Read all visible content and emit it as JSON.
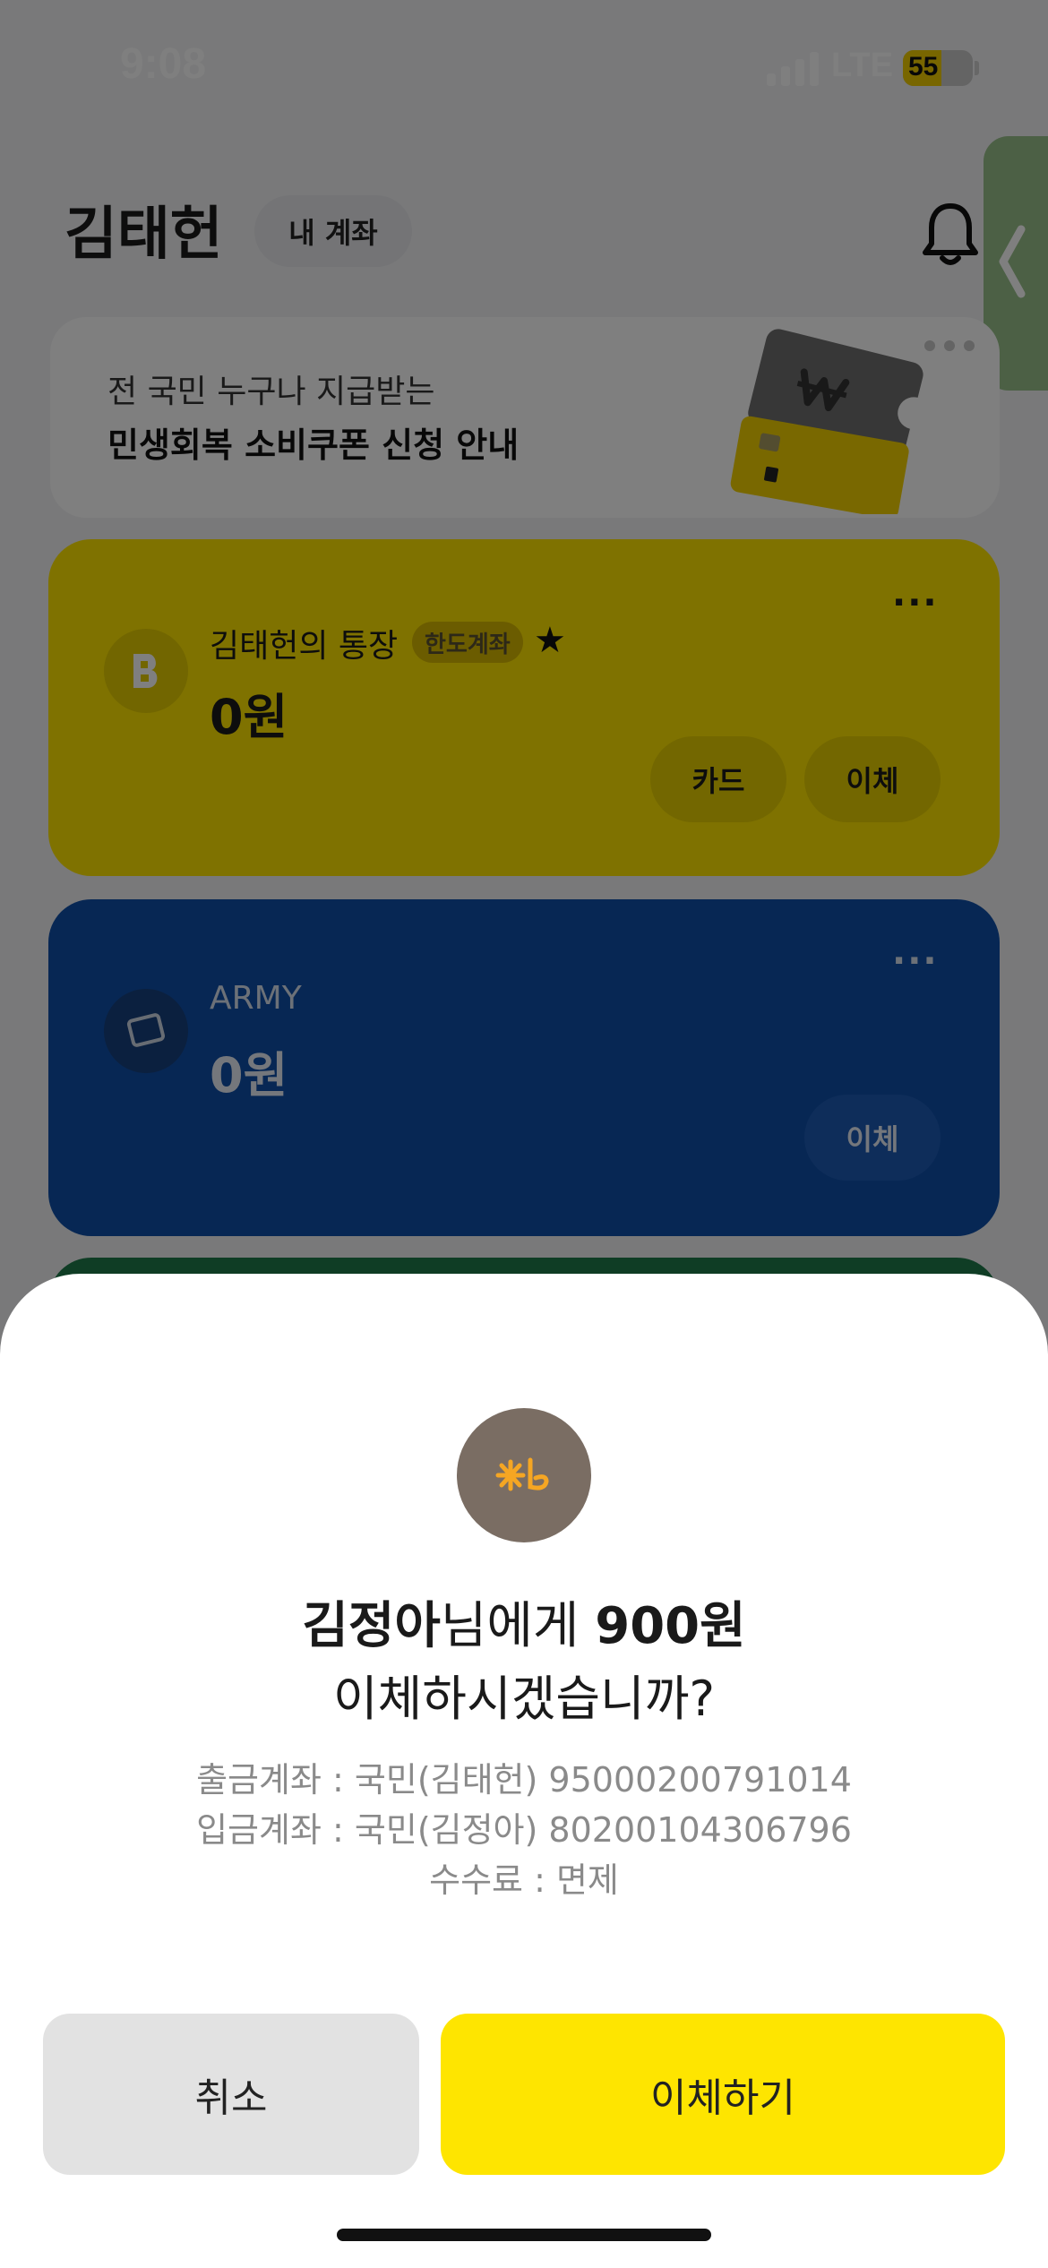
{
  "status_bar": {
    "time": "9:08",
    "network": "LTE",
    "battery": "55",
    "battery_level": 0.55
  },
  "header": {
    "name": "김태헌",
    "my_account_chip": "내 계좌"
  },
  "banner": {
    "subtitle": "전 국민 누구나 지급받는",
    "title": "민생회복 소비쿠폰 신청 안내"
  },
  "accounts": [
    {
      "name": "김태헌의 통장",
      "badge": "한도계좌",
      "balance": "0원",
      "buttons": [
        "카드",
        "이체"
      ],
      "color": "#fee500"
    },
    {
      "name": "ARMY",
      "balance": "0원",
      "buttons": [
        "이체"
      ],
      "color": "#0f4fa8"
    }
  ],
  "dialog": {
    "recipient": "김정아",
    "recipient_suffix": "님에게 ",
    "amount": "900원",
    "question": "이체하시겠습니까?",
    "withdraw_line": "출금계좌 : 국민(김태헌) 95000200791014",
    "deposit_line": "입금계좌 : 국민(김정아) 80200104306796",
    "fee_line": "수수료 : 면제",
    "cancel_label": "취소",
    "confirm_label": "이체하기",
    "bank_logo_color": "#7a6d63",
    "confirm_color": "#fee500"
  },
  "icons": {
    "bank_logo": "kb-star-icon",
    "bell": "bell-icon",
    "side_tab": "chevron-left-icon"
  }
}
